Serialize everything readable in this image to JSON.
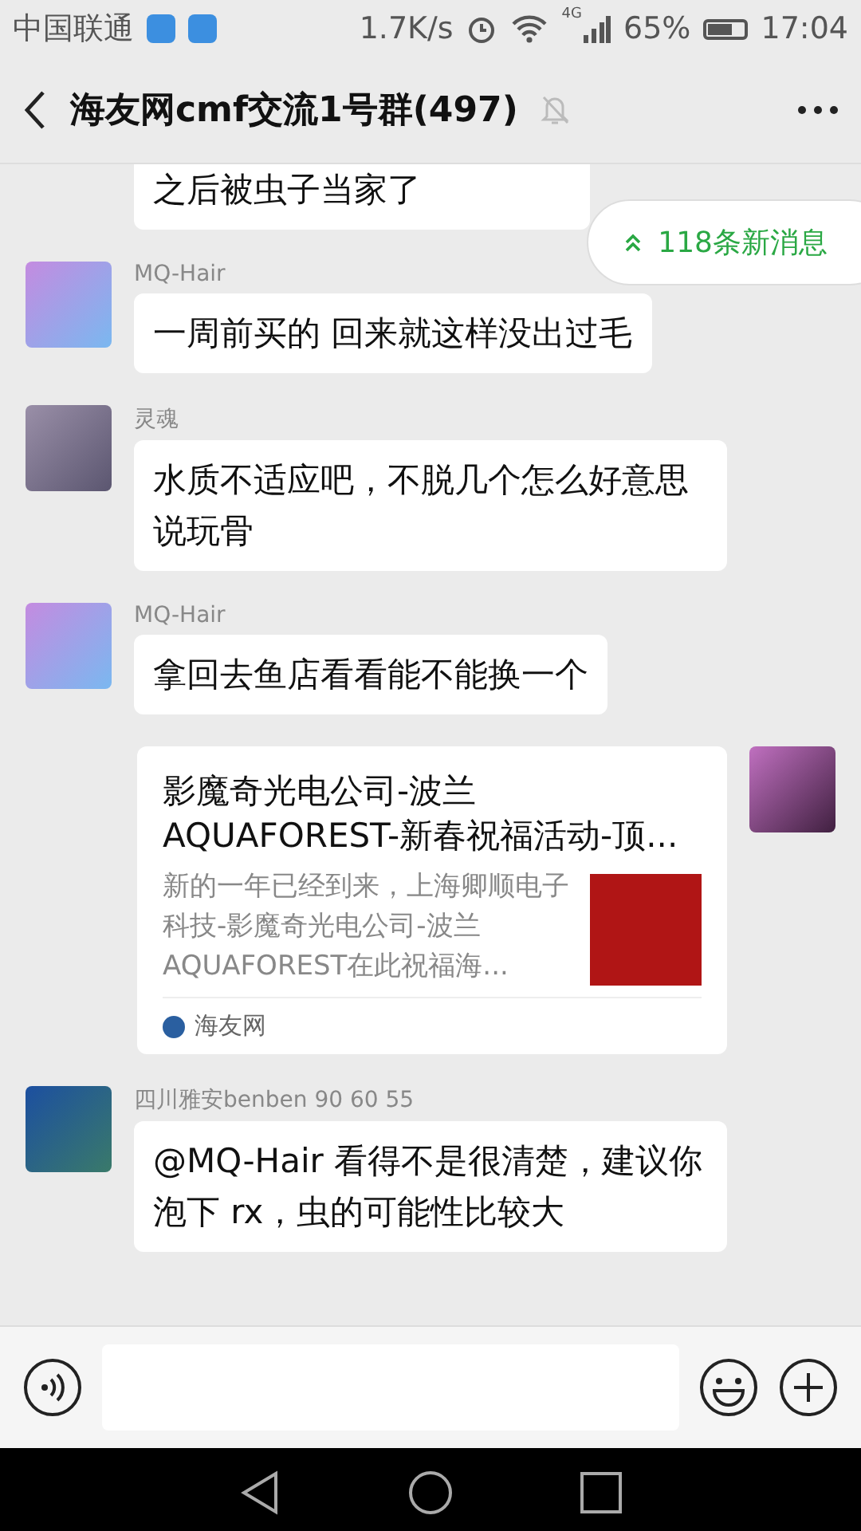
{
  "status_bar": {
    "carrier": "中国联通",
    "speed": "1.7K/s",
    "network": "4G",
    "battery": "65%",
    "time": "17:04"
  },
  "header": {
    "title": "海友网cmf交流1号群(497)",
    "muted": true
  },
  "new_messages": {
    "label": "118条新消息"
  },
  "messages": [
    {
      "kind": "partial",
      "text": "之后被虫子当家了"
    },
    {
      "kind": "text",
      "sender": "MQ-Hair",
      "text": "一周前买的 回来就这样没出过毛"
    },
    {
      "kind": "text",
      "sender": "灵魂",
      "text": "水质不适应吧，不脱几个怎么好意思说玩骨"
    },
    {
      "kind": "text",
      "sender": "MQ-Hair",
      "text": "拿回去鱼店看看能不能换一个"
    },
    {
      "kind": "link",
      "title": "影魔奇光电公司-波兰AQUAFOREST-新春祝福活动-顶...",
      "description": "新的一年已经到来，上海卿顺电子科技-影魔奇光电公司-波兰AQUAFOREST在此祝福海...",
      "source": "海友网"
    },
    {
      "kind": "text",
      "sender": "四川雅安benben 90 60 55",
      "text": "@MQ-Hair  看得不是很清楚，建议你泡下 rx，虫的可能性比较大"
    }
  ]
}
